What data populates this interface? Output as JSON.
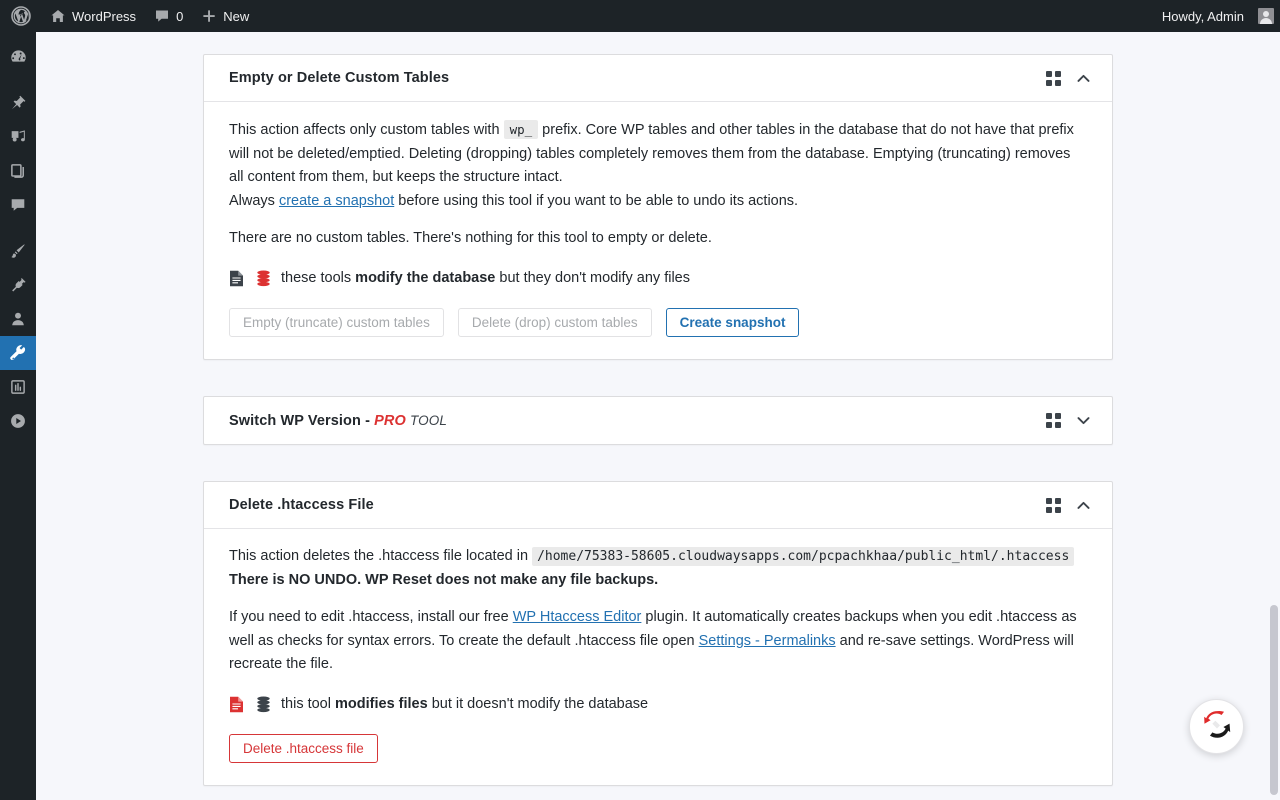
{
  "adminbar": {
    "logo_icon": "wordpress-logo-icon",
    "site_name": "WordPress",
    "site_icon": "home-icon",
    "comments_icon": "comment-bubble-icon",
    "comments_count": "0",
    "new_icon": "plus-icon",
    "new_label": "New",
    "howdy": "Howdy, Admin",
    "avatar_icon": "avatar-icon"
  },
  "sidebar": {
    "items": [
      {
        "name": "dashboard",
        "icon": "dashboard-icon",
        "current": false
      },
      {
        "name": "posts",
        "icon": "pin-icon",
        "current": false
      },
      {
        "name": "media",
        "icon": "media-icon",
        "current": false
      },
      {
        "name": "pages",
        "icon": "pages-icon",
        "current": false
      },
      {
        "name": "comments",
        "icon": "comment-icon",
        "current": false
      },
      {
        "name": "appearance",
        "icon": "paintbrush-icon",
        "current": false
      },
      {
        "name": "plugins",
        "icon": "plug-icon",
        "current": false
      },
      {
        "name": "users",
        "icon": "user-icon",
        "current": false
      },
      {
        "name": "tools",
        "icon": "wrench-icon",
        "current": true
      },
      {
        "name": "settings",
        "icon": "settings-sliders-icon",
        "current": false
      },
      {
        "name": "player",
        "icon": "play-circle-icon",
        "current": false
      }
    ]
  },
  "cards": [
    {
      "id": "empty-or-delete-custom-tables",
      "title": "Empty or Delete Custom Tables",
      "expanded": true,
      "grid_icon": "grid-icon",
      "toggle_icon": "chevron-up-icon",
      "paragraph1_a": "This action affects only custom tables with",
      "paragraph1_code": "wp_",
      "paragraph1_b": "prefix. Core WP tables and other tables in the database that do not have that prefix will not be deleted/emptied. Deleting (dropping) tables completely removes them from the database. Emptying (truncating) removes all content from them, but keeps the structure intact.",
      "paragraph2_a": "Always",
      "paragraph2_link": "create a snapshot",
      "paragraph2_b": "before using this tool if you want to be able to undo its actions.",
      "paragraph3": "There are no custom tables. There's nothing for this tool to empty or delete.",
      "warn_file_icon": "file-icon",
      "warn_db_icon": "database-icon",
      "warn_a": "these tools",
      "warn_bold": "modify the database",
      "warn_b": "but they don't modify any files",
      "buttons": [
        {
          "label": "Empty (truncate) custom tables",
          "name": "empty-truncate-custom-tables-button",
          "style": "disabled"
        },
        {
          "label": "Delete (drop) custom tables",
          "name": "delete-drop-custom-tables-button",
          "style": "disabled"
        },
        {
          "label": "Create snapshot",
          "name": "create-snapshot-button",
          "style": "primary-outline"
        }
      ]
    },
    {
      "id": "switch-wp-version",
      "title": "Switch WP Version - ",
      "pro_label": "PRO",
      "tool_label": "TOOL",
      "expanded": false,
      "grid_icon": "grid-icon",
      "toggle_icon": "chevron-down-icon"
    },
    {
      "id": "delete-htaccess-file",
      "title": "Delete .htaccess File",
      "expanded": true,
      "grid_icon": "grid-icon",
      "toggle_icon": "chevron-up-icon",
      "paragraph1_a": "This action deletes the .htaccess file located in",
      "paragraph1_path": "/home/75383-58605.cloudwaysapps.com/pcpachkhaa/public_html/.htaccess",
      "paragraph1_bold": "There is NO UNDO. WP Reset does not make any file backups.",
      "paragraph2_a": "If you need to edit .htaccess, install our free",
      "paragraph2_link1": "WP Htaccess Editor",
      "paragraph2_b": "plugin. It automatically creates backups when you edit .htaccess as well as checks for syntax errors. To create the default .htaccess file open",
      "paragraph2_link2": "Settings - Permalinks",
      "paragraph2_c": "and re-save settings. WordPress will recreate the file.",
      "warn_file_icon": "file-icon",
      "warn_db_icon": "database-icon",
      "warn_a": "this tool",
      "warn_bold": "modifies files",
      "warn_b": "but it doesn't modify the database",
      "buttons": [
        {
          "label": "Delete .htaccess file",
          "name": "delete-htaccess-file-button",
          "style": "danger-outline"
        }
      ]
    }
  ],
  "fab": {
    "icon": "wp-reset-logo-icon"
  },
  "colors": {
    "adminbar_bg": "#1d2327",
    "accent_blue": "#2271b1",
    "danger_red": "#d63638",
    "pro_red": "#dc3232",
    "page_bg": "#f6f7fb",
    "card_bg": "#ffffff",
    "border": "#dcdcde"
  }
}
